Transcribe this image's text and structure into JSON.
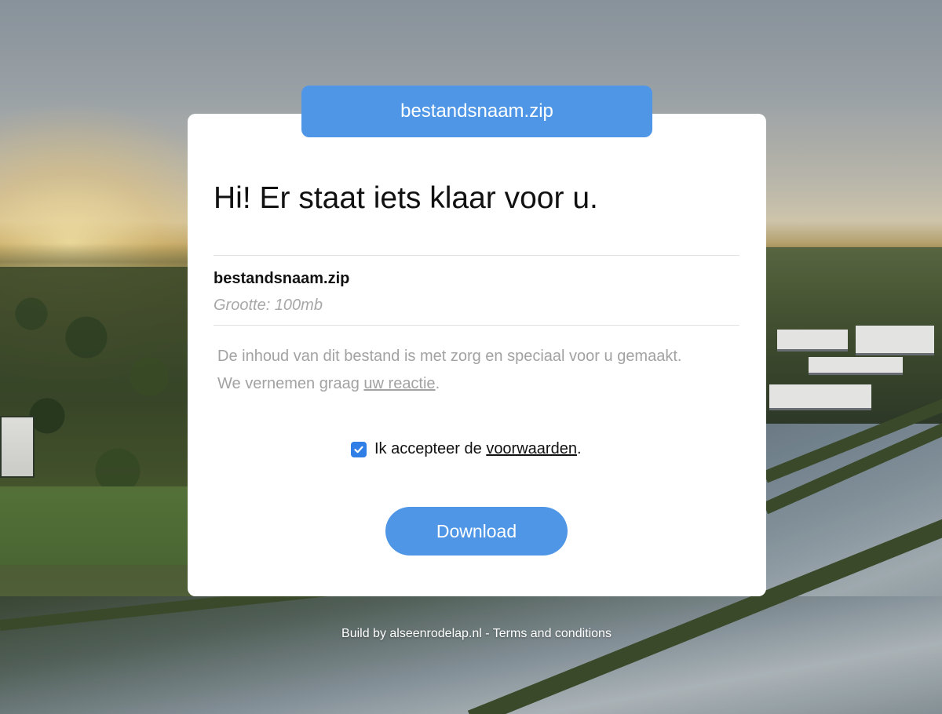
{
  "file_tab": {
    "label": "bestandsnaam.zip"
  },
  "card": {
    "headline": "Hi! Er staat iets klaar voor u.",
    "file": {
      "name": "bestandsnaam.zip",
      "size": "Grootte: 100mb"
    },
    "description": {
      "line1": "De inhoud van dit bestand is met zorg en speciaal voor u gemaakt.",
      "line2_prefix": "We vernemen graag ",
      "line2_link": "uw reactie",
      "line2_suffix": "."
    },
    "terms": {
      "checked": true,
      "prefix": "Ik accepteer de ",
      "link": "voorwaarden",
      "suffix": "."
    },
    "download_label": "Download"
  },
  "footer": {
    "build_text": "Build by alseenrodelap.nl",
    "separator": " - ",
    "terms_link": "Terms and conditions"
  },
  "colors": {
    "accent": "#4f97e6",
    "checkbox": "#2f7fe6",
    "muted_text": "#a2a2a2",
    "card_bg": "#ffffff"
  }
}
